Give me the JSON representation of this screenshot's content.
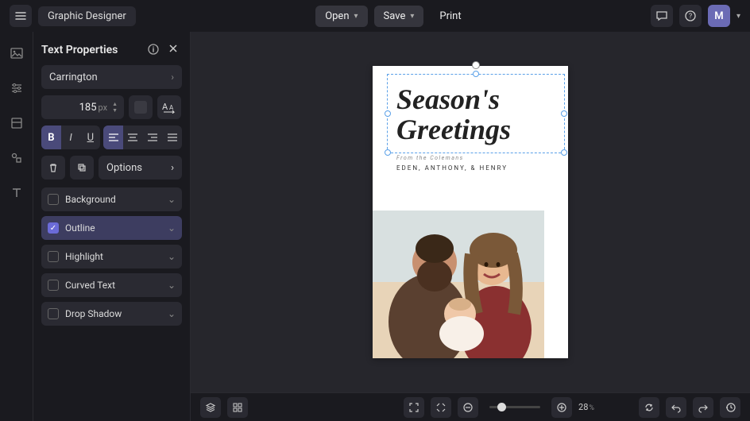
{
  "app": {
    "title": "Graphic Designer"
  },
  "topbar": {
    "open": "Open",
    "save": "Save",
    "print": "Print",
    "avatar_initial": "M"
  },
  "panel": {
    "title": "Text Properties",
    "font_family": "Carrington",
    "font_size": "185",
    "font_size_unit": "px",
    "options": "Options",
    "toggles": {
      "background": "Background",
      "outline": "Outline",
      "highlight": "Highlight",
      "curved_text": "Curved Text",
      "drop_shadow": "Drop Shadow"
    },
    "checked": {
      "outline": true
    },
    "style_states": {
      "bold": true,
      "align_left": true
    }
  },
  "canvas": {
    "card": {
      "line1": "Season's",
      "line2": "Greetings",
      "from": "From the Colemans",
      "names": "EDEN, ANTHONY, & HENRY"
    }
  },
  "bottombar": {
    "zoom": "28",
    "zoom_unit": "%"
  }
}
